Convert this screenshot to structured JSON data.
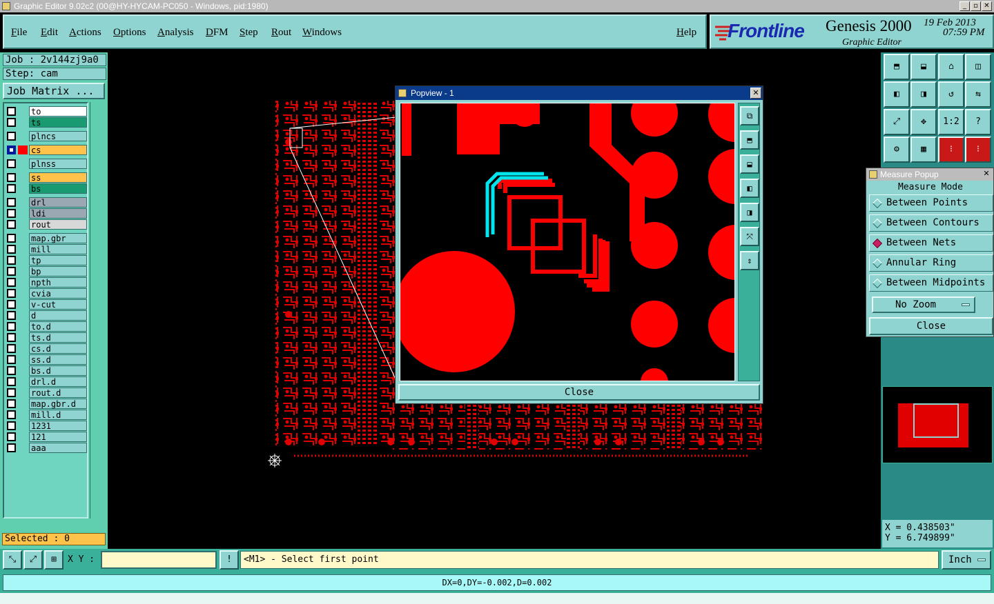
{
  "window": {
    "title": "Graphic Editor 9.02c2 (00@HY-HYCAM-PC050 - Windows, pid:1980)"
  },
  "menu": [
    "File",
    "Edit",
    "Actions",
    "Options",
    "Analysis",
    "DFM",
    "Step",
    "Rout",
    "Windows"
  ],
  "help": "Help",
  "brand": {
    "logo": "Frontline",
    "product": "Genesis 2000",
    "subtitle": "Graphic Editor",
    "date": "19 Feb 2013",
    "time": "07:59 PM"
  },
  "job": {
    "label": "Job : 2v144zj9a0",
    "step": "Step: cam",
    "matrix_button": "Job Matrix ..."
  },
  "layers": [
    {
      "name": "to",
      "color": "#ffffff"
    },
    {
      "name": "ts",
      "color": "#1a9a70"
    },
    {
      "name": "plncs",
      "color": "#8fd4d0"
    },
    {
      "name": "cs",
      "color": "#ffc24a",
      "active": true
    },
    {
      "name": "plnss",
      "color": "#8fd4d0"
    },
    {
      "name": "ss",
      "color": "#ffc24a"
    },
    {
      "name": "bs",
      "color": "#1a9a70"
    },
    {
      "name": "drl",
      "color": "#9aa8b4"
    },
    {
      "name": "ldi",
      "color": "#9aa8b4"
    },
    {
      "name": "rout",
      "color": "#d8d8d8"
    },
    {
      "name": "map.gbr",
      "color": "#8fd4d0"
    },
    {
      "name": "mill",
      "color": "#8fd4d0"
    },
    {
      "name": "tp",
      "color": "#8fd4d0"
    },
    {
      "name": "bp",
      "color": "#8fd4d0"
    },
    {
      "name": "npth",
      "color": "#8fd4d0"
    },
    {
      "name": "cvia",
      "color": "#8fd4d0"
    },
    {
      "name": "v-cut",
      "color": "#8fd4d0"
    },
    {
      "name": "d",
      "color": "#8fd4d0"
    },
    {
      "name": "to.d",
      "color": "#8fd4d0"
    },
    {
      "name": "ts.d",
      "color": "#8fd4d0"
    },
    {
      "name": "cs.d",
      "color": "#8fd4d0"
    },
    {
      "name": "ss.d",
      "color": "#8fd4d0"
    },
    {
      "name": "bs.d",
      "color": "#8fd4d0"
    },
    {
      "name": "drl.d",
      "color": "#8fd4d0"
    },
    {
      "name": "rout.d",
      "color": "#8fd4d0"
    },
    {
      "name": "map.gbr.d",
      "color": "#8fd4d0"
    },
    {
      "name": "mill.d",
      "color": "#8fd4d0"
    },
    {
      "name": "1231",
      "color": "#8fd4d0"
    },
    {
      "name": "121",
      "color": "#8fd4d0"
    },
    {
      "name": "aaa",
      "color": "#8fd4d0"
    }
  ],
  "selected": "Selected : 0",
  "popview": {
    "title": "Popview - 1",
    "close": "Close"
  },
  "measure": {
    "title": "Measure Popup",
    "header": "Measure Mode",
    "options": [
      "Between Points",
      "Between Contours",
      "Between Nets",
      "Annular Ring",
      "Between Midpoints"
    ],
    "selected": "Between Nets",
    "zoom": "No Zoom",
    "close": "Close"
  },
  "coords": {
    "x": "X = 0.438503\"",
    "y": "Y = 6.749899\""
  },
  "bottom": {
    "xy_label": "X Y :",
    "xy_value": "",
    "message": "<M1> - Select first point",
    "unit": "Inch"
  },
  "status": "DX=0,DY=-0.002,D=0.002",
  "toolbar_tools": [
    "1:2",
    "?"
  ],
  "colors": {
    "feature": "#ff0000",
    "highlight": "#00e5ee",
    "panel": "#8fd4d0"
  }
}
